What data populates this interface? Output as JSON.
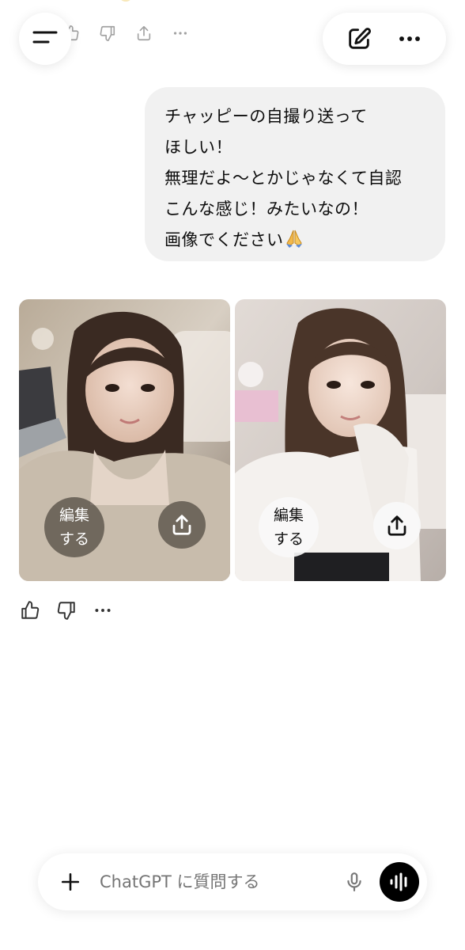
{
  "message": {
    "lines": [
      "チャッピーの自撮り送って",
      "ほしい！",
      "無理だよ〜とかじゃなくて自認",
      "こんな感じ！みたいなの！",
      "画像でください"
    ],
    "emoji_icon": "folded-hands-icon"
  },
  "images": [
    {
      "edit_label_1": "編集",
      "edit_label_2": "する",
      "share_icon": "share-icon"
    },
    {
      "edit_label_1": "編集",
      "edit_label_2": "する",
      "share_icon": "share-icon"
    }
  ],
  "composer": {
    "placeholder": "ChatGPT に質問する",
    "icons": [
      "plus-icon",
      "microphone-icon",
      "voice-mode-icon"
    ]
  },
  "header": {
    "icons": [
      "menu-icon",
      "new-chat-icon",
      "more-options-icon"
    ]
  },
  "colors": {
    "bubble": "#f1f1f1",
    "voice_button": "#000000",
    "text": "#0d0d0d",
    "placeholder": "#9a9a9a"
  }
}
